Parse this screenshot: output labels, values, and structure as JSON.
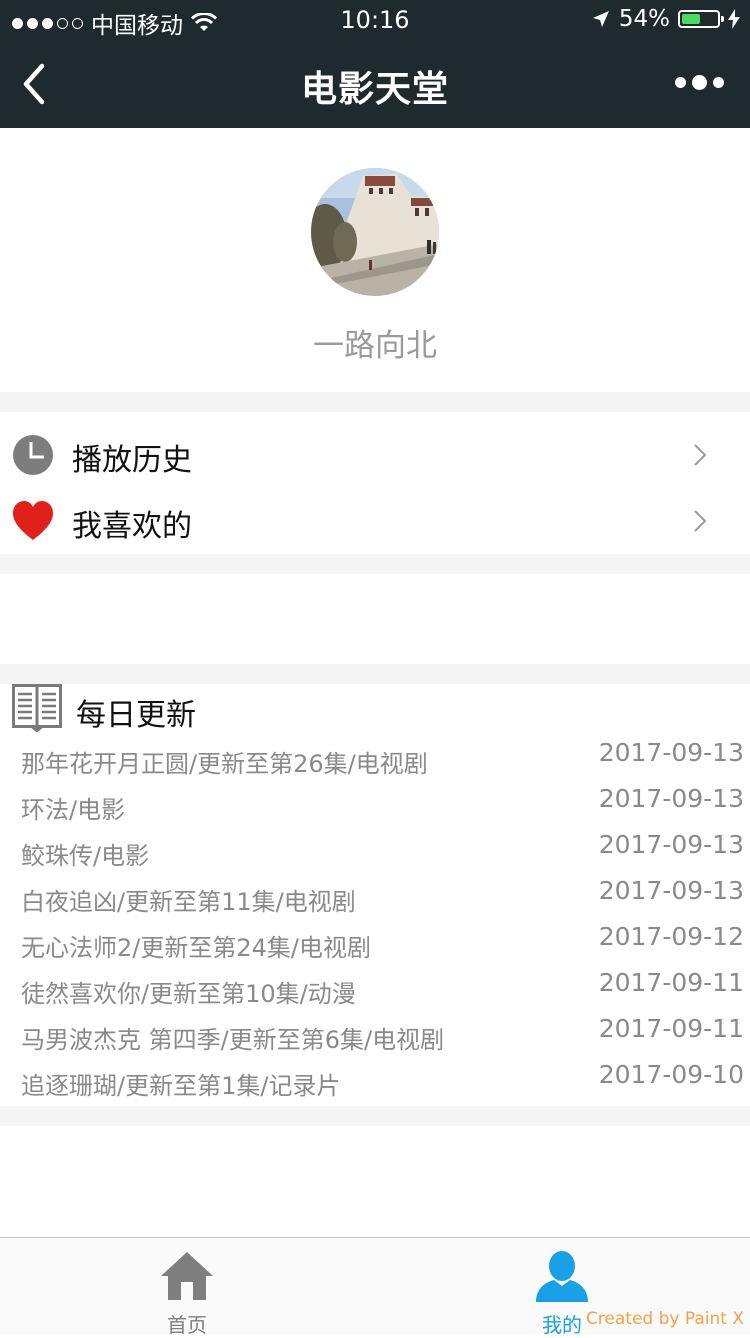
{
  "status_bar": {
    "carrier": "中国移动",
    "time": "10:16",
    "battery_percent": "54%",
    "battery_level": 0.54,
    "signal_strength": 3,
    "signal_max": 5
  },
  "nav": {
    "title": "电影天堂",
    "back_icon": "chevron-left-icon",
    "more_icon": "more-dots-icon"
  },
  "profile": {
    "username": "一路向北"
  },
  "menu": [
    {
      "label": "播放历史",
      "icon": "clock-icon"
    },
    {
      "label": "我喜欢的",
      "icon": "heart-icon"
    }
  ],
  "daily": {
    "title": "每日更新",
    "icon": "book-icon",
    "items": [
      {
        "title": "那年花开月正圆/更新至第26集/电视剧",
        "date": "2017-09-13"
      },
      {
        "title": "环法/电影",
        "date": "2017-09-13"
      },
      {
        "title": "鲛珠传/电影",
        "date": "2017-09-13"
      },
      {
        "title": "白夜追凶/更新至第11集/电视剧",
        "date": "2017-09-13"
      },
      {
        "title": "无心法师2/更新至第24集/电视剧",
        "date": "2017-09-12"
      },
      {
        "title": "徒然喜欢你/更新至第10集/动漫",
        "date": "2017-09-11"
      },
      {
        "title": "马男波杰克 第四季/更新至第6集/电视剧",
        "date": "2017-09-11"
      },
      {
        "title": "追逐珊瑚/更新至第1集/记录片",
        "date": "2017-09-10"
      }
    ]
  },
  "tabbar": {
    "tabs": [
      {
        "label": "首页",
        "icon": "home-icon",
        "active": false
      },
      {
        "label": "我的",
        "icon": "person-icon",
        "active": true
      }
    ],
    "active_color": "#1aa0e6",
    "inactive_color": "#7f7f7f"
  },
  "watermark": "Created by Paint X",
  "colors": {
    "nav_background": "#1f2a2f",
    "heart": "#e0201b",
    "battery_fill": "#4cd964"
  }
}
